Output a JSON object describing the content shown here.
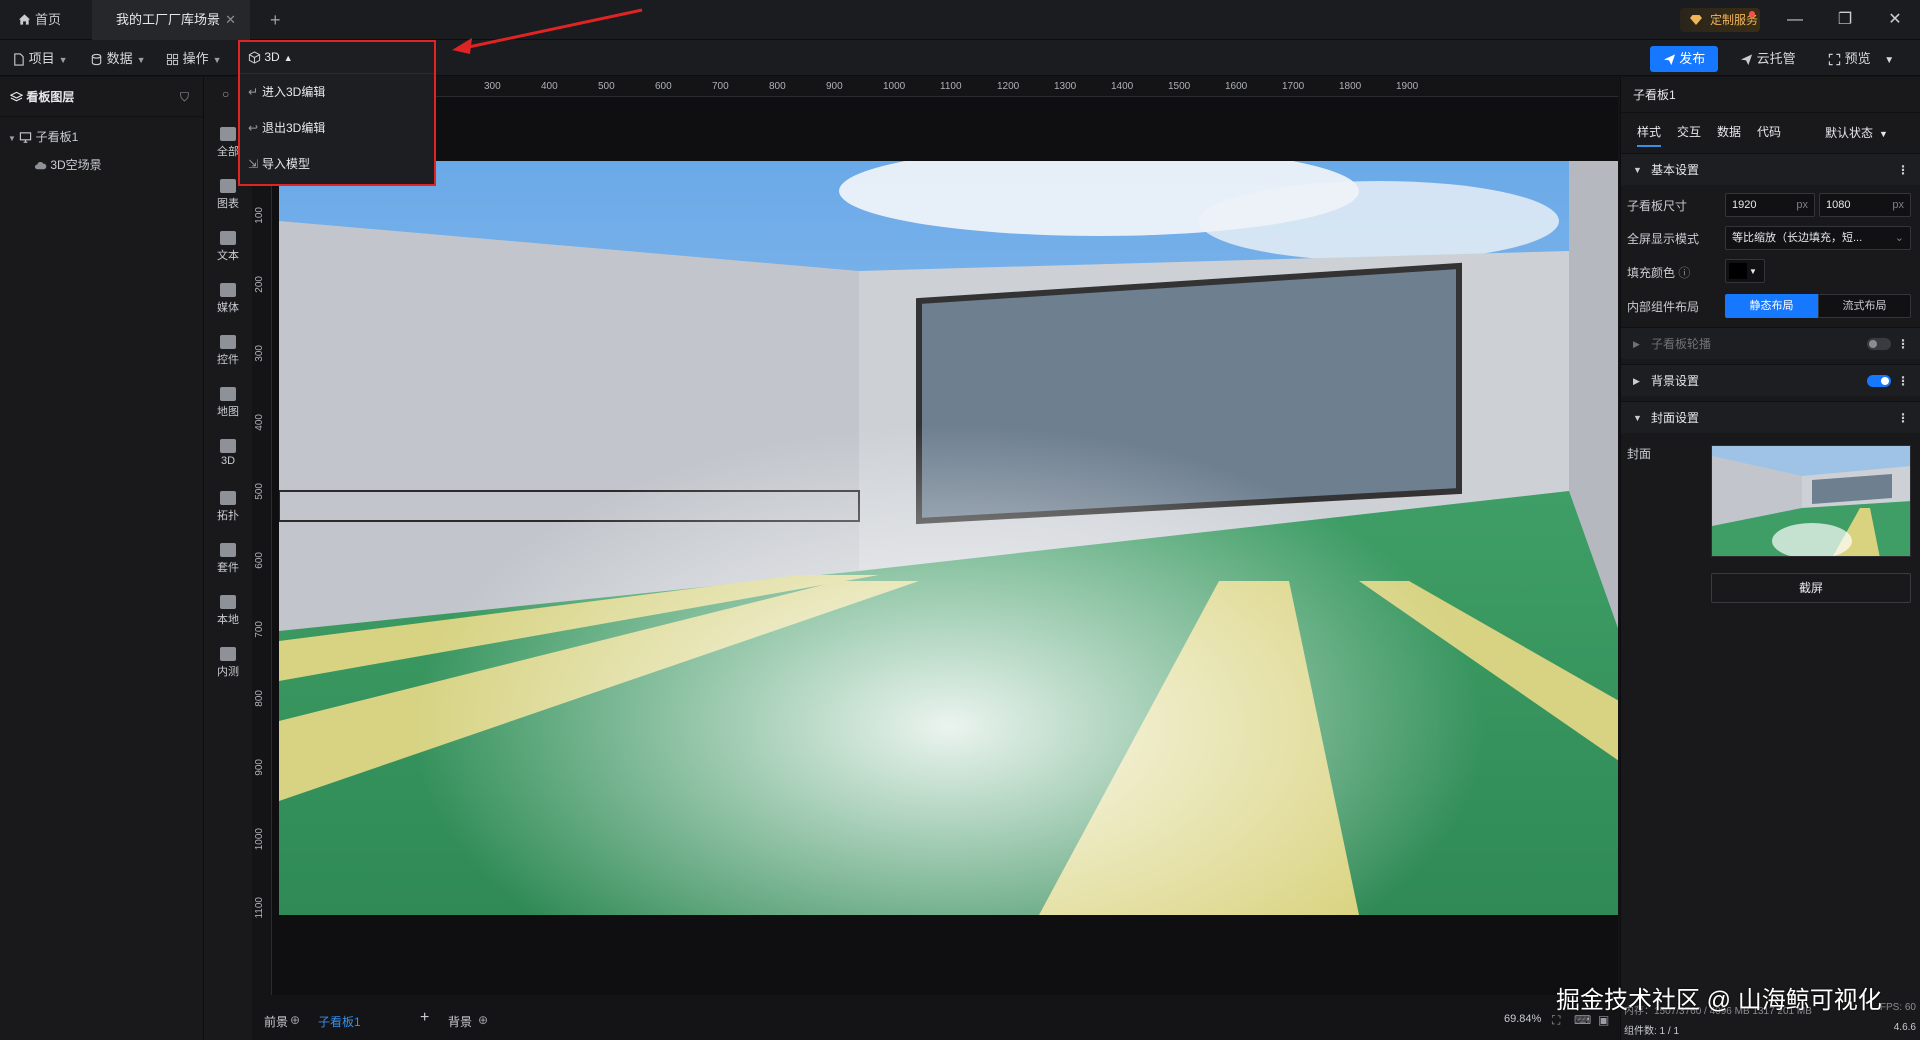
{
  "titlebar": {
    "home_tab": "首页",
    "active_tab": "我的工厂厂库场景",
    "add_tab": "+",
    "custom_service": "定制服务"
  },
  "toolbar": {
    "project": "项目",
    "data": "数据",
    "operate": "操作",
    "three_d": "3D",
    "publish": "发布",
    "cloud": "云托管",
    "preview": "预览"
  },
  "menu3d": {
    "title": "3D",
    "items": [
      "进入3D编辑",
      "退出3D编辑",
      "导入模型"
    ]
  },
  "layer_panel": {
    "title": "看板图层",
    "tree": [
      {
        "label": "子看板1"
      },
      {
        "label": "3D空场景"
      }
    ]
  },
  "component_rail": {
    "items": [
      "全部",
      "图表",
      "文本",
      "媒体",
      "控件",
      "地图",
      "3D",
      "拓扑",
      "套件",
      "本地",
      "内测"
    ]
  },
  "rulers": {
    "h_ticks": [
      "300",
      "400",
      "500",
      "600",
      "700",
      "800",
      "900",
      "1000",
      "1100",
      "1200",
      "1300",
      "1400",
      "1500",
      "1600",
      "1700",
      "1800",
      "1900"
    ],
    "v_ticks": [
      "100",
      "200",
      "300",
      "400",
      "500",
      "600",
      "700",
      "800",
      "900",
      "1000",
      "1100"
    ]
  },
  "bottom": {
    "foreground": "前景",
    "sub_board": "子看板1",
    "background": "背景",
    "zoom": "69.84%"
  },
  "props": {
    "title": "子看板1",
    "tabs": [
      "样式",
      "交互",
      "数据",
      "代码"
    ],
    "state": "默认状态",
    "basic_section": "基本设置",
    "size_label": "子看板尺寸",
    "width": "1920",
    "height": "1080",
    "unit": "px",
    "fullscreen_label": "全屏显示模式",
    "fullscreen_value": "等比缩放（长边填充，短...",
    "fill_label": "填充颜色",
    "layout_label": "内部组件布局",
    "layout_static": "静态布局",
    "layout_flow": "流式布局",
    "carousel_section": "子看板轮播",
    "bg_section": "背景设置",
    "cover_section": "封面设置",
    "cover_label": "封面",
    "screenshot_btn": "截屏",
    "memory_text": "内存：1507/3760 / 4096 MB  1317 201 MB",
    "fps": "FPS: 60",
    "component_count": "组件数: 1 / 1",
    "version": "4.6.6"
  },
  "watermark": "掘金技术社区 @ 山海鲸可视化",
  "colors": {
    "accent": "#1677ff",
    "highlight_border": "#e02323"
  }
}
